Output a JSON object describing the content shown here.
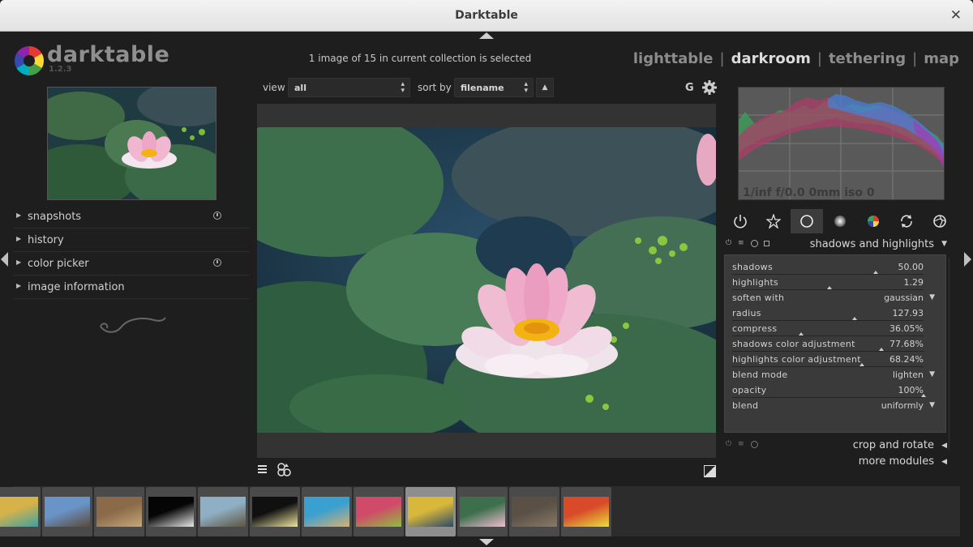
{
  "window": {
    "title": "Darktable",
    "close_glyph": "✕"
  },
  "app": {
    "name": "darktable",
    "version": "1.2.3"
  },
  "status": {
    "selection": "1 image of 15 in current collection is selected"
  },
  "views": {
    "items": [
      {
        "label": "lighttable",
        "active": false
      },
      {
        "label": "darkroom",
        "active": true
      },
      {
        "label": "tethering",
        "active": false
      },
      {
        "label": "map",
        "active": false
      }
    ],
    "separator": "|"
  },
  "left_panel": {
    "modules": [
      {
        "label": "snapshots",
        "has_reset": true
      },
      {
        "label": "history",
        "has_reset": false
      },
      {
        "label": "color picker",
        "has_reset": true
      },
      {
        "label": "image information",
        "has_reset": false
      }
    ]
  },
  "toolbar": {
    "view_label": "view",
    "view_value": "all",
    "sort_label": "sort by",
    "sort_value": "filename",
    "sort_direction_glyph": "▲",
    "grouping_label": "G"
  },
  "histogram": {
    "info": "1/inf f/0.0 0mm iso 0"
  },
  "module_groups": [
    "power-icon",
    "star-icon",
    "circle-icon",
    "tone-icon",
    "color-icon",
    "correct-icon",
    "effect-icon"
  ],
  "active_module": {
    "name": "shadows and highlights",
    "params": [
      {
        "name": "shadows",
        "value": "50.00",
        "type": "slider",
        "level": 0.75
      },
      {
        "name": "highlights",
        "value": "1.29",
        "type": "slider",
        "level": 0.51
      },
      {
        "name": "soften with",
        "value": "gaussian",
        "type": "dropdown"
      },
      {
        "name": "radius",
        "value": "127.93",
        "type": "slider",
        "level": 0.64
      },
      {
        "name": "compress",
        "value": "36.05%",
        "type": "slider",
        "level": 0.36
      },
      {
        "name": "shadows color adjustment",
        "value": "77.68%",
        "type": "slider",
        "level": 0.78
      },
      {
        "name": "highlights color adjustment",
        "value": "68.24%",
        "type": "slider",
        "level": 0.68
      },
      {
        "name": "blend mode",
        "value": "lighten",
        "type": "dropdown"
      },
      {
        "name": "opacity",
        "value": "100%",
        "type": "slider",
        "level": 1.0
      },
      {
        "name": "blend",
        "value": "uniformly",
        "type": "dropdown"
      }
    ]
  },
  "other_modules": [
    {
      "name": "crop and rotate"
    },
    {
      "name": "more modules"
    }
  ],
  "filmstrip": {
    "count": 12,
    "selected_index": 8
  }
}
